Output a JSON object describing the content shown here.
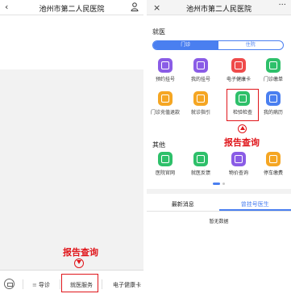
{
  "left": {
    "header": {
      "back_glyph": "‹",
      "title": "池州市第二人民医院"
    },
    "annotation": "报告查询",
    "bottom_tabs": [
      "导诊",
      "就医服务",
      "电子健康卡"
    ]
  },
  "right": {
    "header": {
      "close_glyph": "×",
      "title": "池州市第二人民医院",
      "more_glyph": "···"
    },
    "section_medical": "就医",
    "segment": {
      "outpatient": "门诊",
      "inpatient": "住院"
    },
    "services": [
      {
        "label": "预约挂号",
        "color": "#8a5ce6",
        "icon": "calendar-icon"
      },
      {
        "label": "我的挂号",
        "color": "#8a5ce6",
        "icon": "user-clipboard-icon"
      },
      {
        "label": "电子健康卡",
        "color": "#ef4b4b",
        "icon": "card-icon"
      },
      {
        "label": "门诊缴单",
        "color": "#2ec06a",
        "icon": "payment-icon"
      },
      {
        "label": "门诊充值退款",
        "color": "#f5a623",
        "icon": "wallet-icon"
      },
      {
        "label": "就诊指引",
        "color": "#f5a623",
        "icon": "guide-icon"
      },
      {
        "label": "检验检查",
        "color": "#2ec06a",
        "icon": "report-icon"
      },
      {
        "label": "我的病历",
        "color": "#4a7ff0",
        "icon": "record-icon"
      }
    ],
    "annotation": "报告查询",
    "section_other": "其他",
    "other_services": [
      {
        "label": "医院官网",
        "color": "#2ec06a",
        "icon": "website-icon"
      },
      {
        "label": "就医反馈",
        "color": "#2ec06a",
        "icon": "feedback-icon"
      },
      {
        "label": "物价查询",
        "color": "#8a5ce6",
        "icon": "price-icon"
      },
      {
        "label": "停车缴费",
        "color": "#f5a623",
        "icon": "parking-icon"
      }
    ],
    "news_tabs": {
      "latest": "最新消息",
      "doctor": "曾挂号医生"
    },
    "empty_text": "暂无数据"
  }
}
